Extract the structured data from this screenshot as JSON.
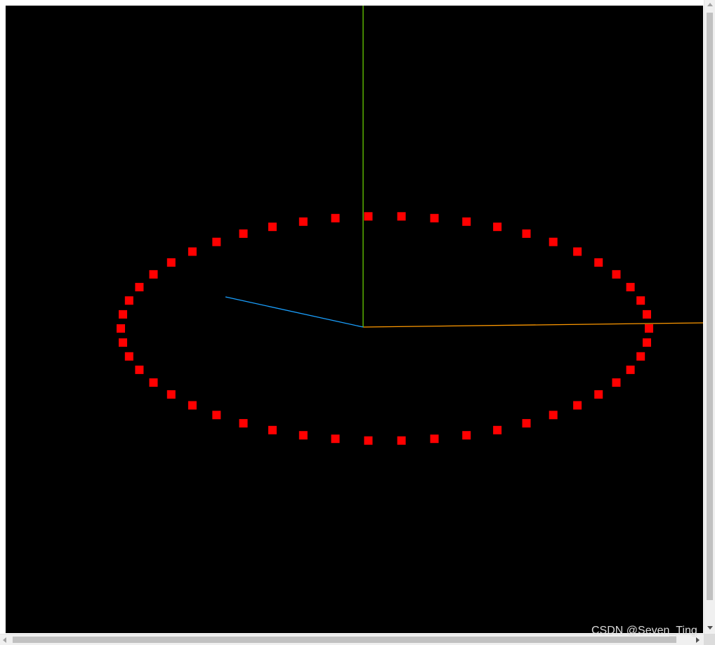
{
  "scene": {
    "background": "#000000",
    "point_color": "#ff0000",
    "point_count": 50,
    "axes": [
      {
        "name": "x",
        "color": "#ff9900"
      },
      {
        "name": "y",
        "color": "#66cc00"
      },
      {
        "name": "z",
        "color": "#1aa0ff"
      }
    ]
  },
  "watermark": {
    "text": "CSDN @Seven_Ting"
  }
}
